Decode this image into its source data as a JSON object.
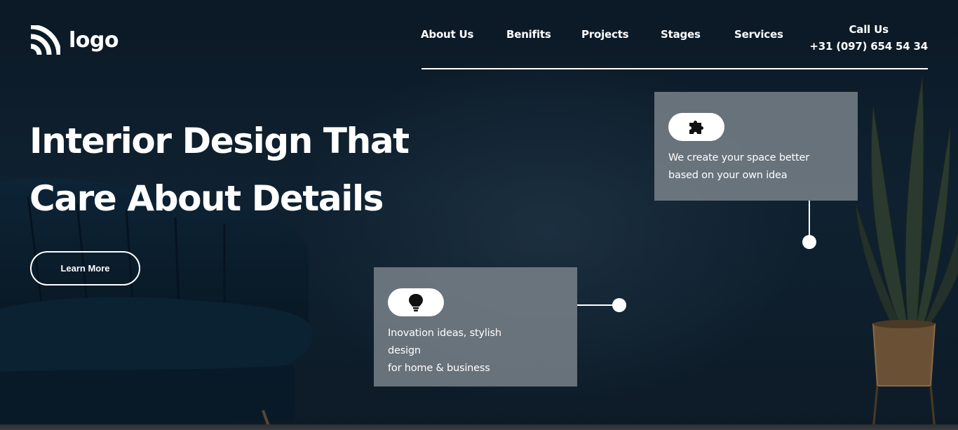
{
  "logo": {
    "text": "logo",
    "icon": "signal-arcs-icon"
  },
  "nav": {
    "items": [
      {
        "label": "About Us"
      },
      {
        "label": "Benifits"
      },
      {
        "label": "Projects"
      },
      {
        "label": "Stages"
      },
      {
        "label": "Services"
      }
    ],
    "call_label": "Call Us",
    "call_number": "+31 (097) 654 54 34"
  },
  "hero": {
    "headline_line1": "Interior Design That",
    "headline_line2": "Care About Details",
    "cta_label": "Learn More"
  },
  "cards": [
    {
      "icon": "puzzle-piece-icon",
      "text": "We create your space better\nbased on your own idea"
    },
    {
      "icon": "lightbulb-icon",
      "text": "Inovation ideas, stylish\ndesign\nfor home & business"
    }
  ],
  "colors": {
    "background": "#0c1926",
    "card": "#7d858c",
    "text": "#ffffff"
  }
}
